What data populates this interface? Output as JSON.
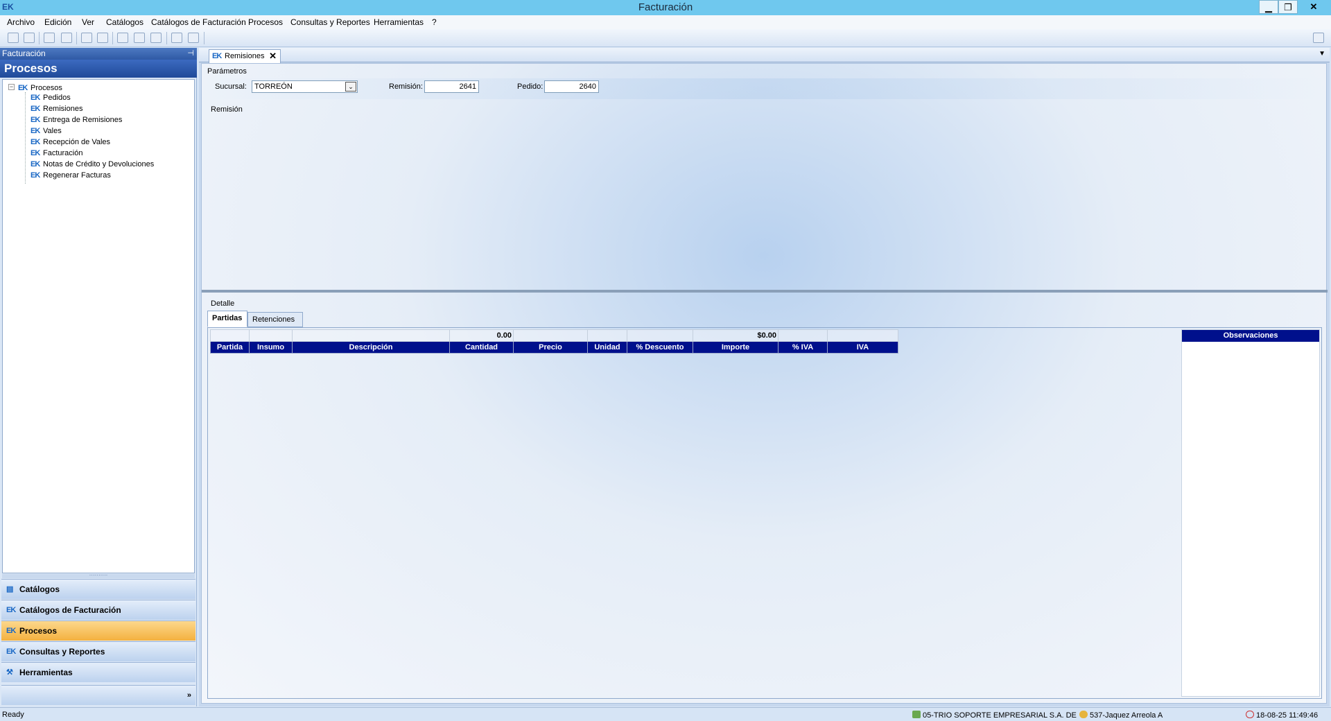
{
  "window": {
    "title": "Facturación",
    "app_icon": "EK",
    "min_symbol": "▁",
    "max_symbol": "❐",
    "close_symbol": "✕"
  },
  "menu": [
    "Archivo",
    "Edición",
    "Ver",
    "Catálogos",
    "Catálogos de Facturación",
    "Procesos",
    "Consultas y Reportes",
    "Herramientas",
    "?"
  ],
  "toolbar": {
    "icons": [
      "save-icon",
      "save-all-icon",
      "print-icon",
      "print-preview-icon",
      "edit-icon",
      "find-icon",
      "grid-icon",
      "list-icon",
      "delete-icon",
      "copy-icon",
      "refresh-icon",
      "exit-icon"
    ]
  },
  "left_panel": {
    "header": "Facturación",
    "pin_symbol": "⊣",
    "title": "Procesos",
    "tree": {
      "root_expander": "−",
      "root": "Procesos",
      "items": [
        "Pedidos",
        "Remisiones",
        "Entrega de Remisiones",
        "Vales",
        "Recepción de Vales",
        "Facturación",
        "Notas de Crédito y Devoluciones",
        "Regenerar Facturas"
      ]
    },
    "splitter_dots": "··········",
    "nav_buttons": [
      {
        "label": "Catálogos",
        "icon": "catalog-icon",
        "glyph": "▤",
        "active": false
      },
      {
        "label": "Catálogos de Facturación",
        "icon": "ek-icon",
        "glyph": "EK",
        "active": false
      },
      {
        "label": "Procesos",
        "icon": "ek-icon",
        "glyph": "EK",
        "active": true
      },
      {
        "label": "Consultas y Reportes",
        "icon": "ek-icon",
        "glyph": "EK",
        "active": false
      },
      {
        "label": "Herramientas",
        "icon": "tools-icon",
        "glyph": "⚒",
        "active": false
      }
    ],
    "nav_more": "»"
  },
  "document": {
    "tab_label": "Remisiones",
    "tab_close": "✕",
    "tab_dropdown": "▼",
    "parametros": {
      "group_label": "Parámetros",
      "sucursal_label": "Sucursal:",
      "sucursal_value": "TORREÓN",
      "remision_label": "Remisión:",
      "remision_value": "2641",
      "pedido_label": "Pedido:",
      "pedido_value": "2640",
      "dropdown_symbol": "⌄"
    },
    "remision_group_label": "Remisión",
    "detalle": {
      "group_label": "Detalle",
      "tabs": [
        "Partidas",
        "Retenciones"
      ],
      "totals": {
        "cantidad": "0.00",
        "importe": "$0.00"
      },
      "columns": [
        "Partida",
        "Insumo",
        "Descripción",
        "Cantidad",
        "Precio",
        "Unidad",
        "% Descuento",
        "Importe",
        "% IVA",
        "IVA"
      ],
      "observaciones_label": "Observaciones"
    }
  },
  "status": {
    "ready": "Ready",
    "company": "05-TRIO SOPORTE EMPRESARIAL S.A. DE",
    "user": "537-Jaquez Arreola A",
    "datetime": "18-08-25 11:49:46"
  }
}
